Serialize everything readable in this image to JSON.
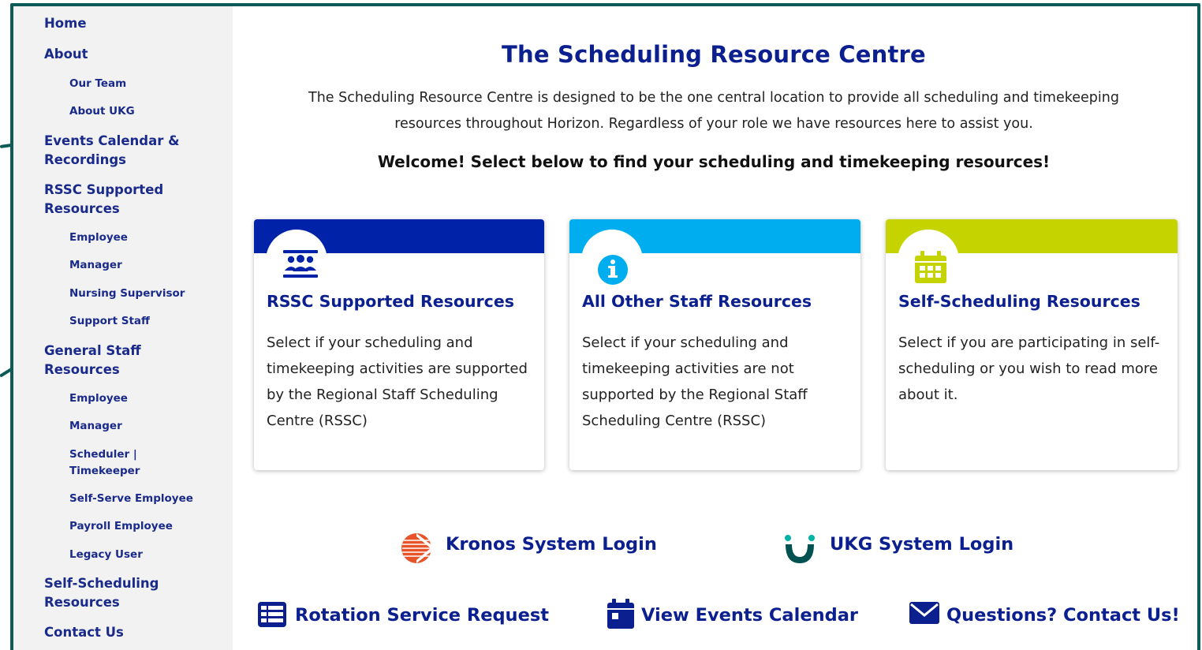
{
  "nav": {
    "home": "Home",
    "about": "About",
    "our_team": "Our Team",
    "about_ukg": "About UKG",
    "events_calendar": "Events Calendar & Recordings",
    "rssc_supported": "RSSC Supported Resources",
    "rssc_employee": "Employee",
    "rssc_manager": "Manager",
    "rssc_nursing_supervisor": "Nursing Supervisor",
    "rssc_support_staff": "Support Staff",
    "general_staff": "General Staff Resources",
    "gs_employee": "Employee",
    "gs_manager": "Manager",
    "gs_scheduler": "Scheduler | Timekeeper",
    "gs_self_serve": "Self-Serve Employee",
    "gs_payroll": "Payroll Employee",
    "gs_legacy": "Legacy User",
    "self_scheduling": "Self-Scheduling Resources",
    "contact": "Contact Us"
  },
  "main": {
    "title": "The Scheduling Resource Centre",
    "intro": "The Scheduling Resource Centre is designed to be the one central location to provide all scheduling and timekeeping resources throughout Horizon. Regardless of your role we have resources here to assist you.",
    "welcome": "Welcome!  Select below to find your scheduling and timekeeping resources!"
  },
  "cards": [
    {
      "title": "RSSC Supported Resources",
      "text": "Select if your scheduling and timekeeping activities are supported by the Regional Staff Scheduling Centre (RSSC)",
      "icon": "group-icon",
      "color": "#0022a8"
    },
    {
      "title": "All Other Staff Resources",
      "text": "Select if your scheduling and timekeeping activities are not supported by the Regional Staff Scheduling Centre (RSSC)",
      "icon": "info-icon",
      "color": "#00aeef"
    },
    {
      "title": "Self-Scheduling Resources",
      "text": "Select if you are participating in self-scheduling or you wish to read more about it.",
      "icon": "calendar-icon",
      "color": "#c5d400"
    }
  ],
  "links": {
    "kronos": "Kronos System Login",
    "ukg": "UKG System Login",
    "rotation": "Rotation Service Request",
    "events": "View Events Calendar",
    "contact": "Questions? Contact Us!"
  },
  "colors": {
    "frame": "#0e5a57",
    "heading": "#0b1f8f",
    "kronos_orange": "#e8542a",
    "ukg_teal": "#005151"
  }
}
